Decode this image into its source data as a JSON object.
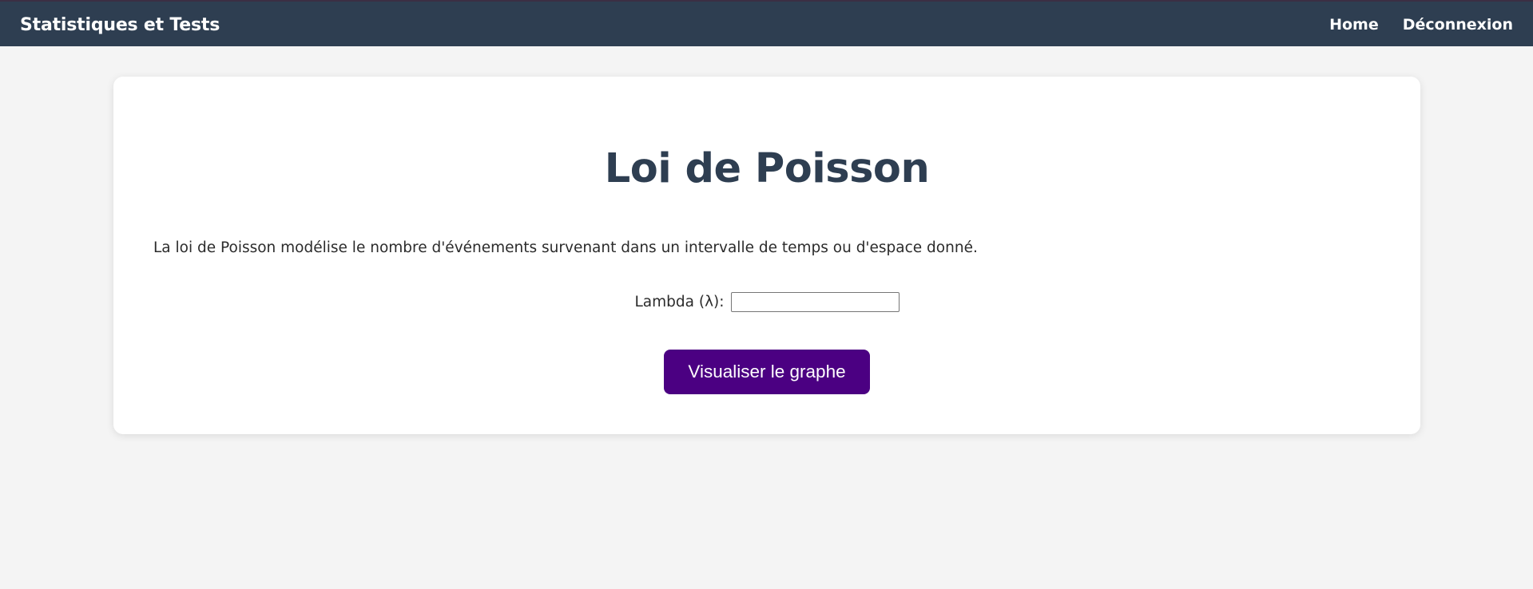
{
  "navbar": {
    "brand": "Statistiques et Tests",
    "links": [
      {
        "label": "Home"
      },
      {
        "label": "Déconnexion"
      }
    ]
  },
  "main": {
    "title": "Loi de Poisson",
    "description": "La loi de Poisson modélise le nombre d'événements survenant dans un intervalle de temps ou d'espace donné.",
    "form": {
      "lambda_label": "Lambda (λ):",
      "lambda_value": "",
      "submit_label": "Visualiser le graphe"
    }
  },
  "colors": {
    "navbar_background": "#2e3e51",
    "title_color": "#2e3e51",
    "button_background": "#4b0082",
    "page_background": "#f4f4f4"
  }
}
